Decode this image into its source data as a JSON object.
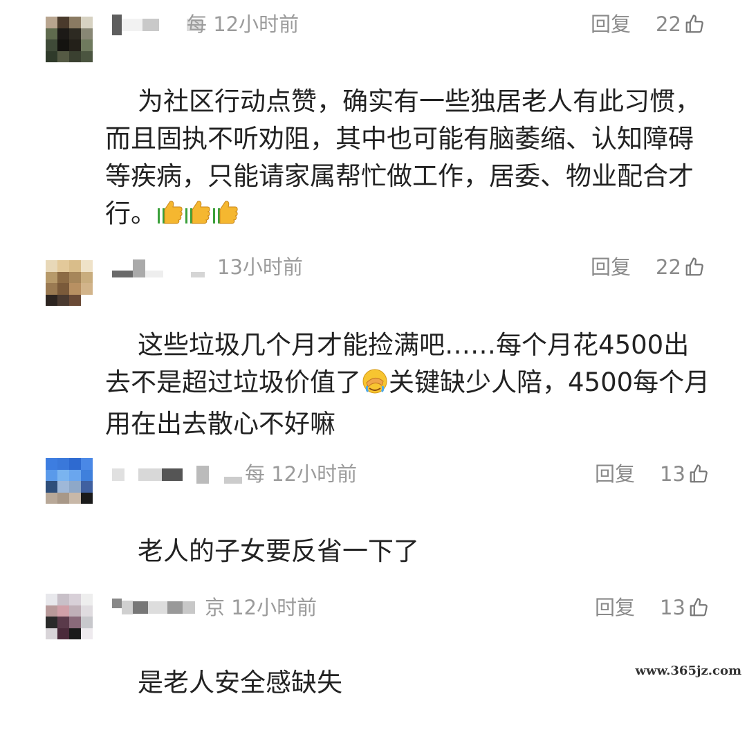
{
  "comments": [
    {
      "location_time": "每 12小时前",
      "reply_label": "回复",
      "likes": "22",
      "text": "为社区行动点赞，确实有一些独居老人有此习惯，而且固执不听劝阻，其中也可能有脑萎缩、认知障碍等疾病，只能请家属帮忙做工作，居委、物业配合才行。",
      "emoji": "thumbs-up x3"
    },
    {
      "location_time": "13小时前",
      "reply_label": "回复",
      "likes": "22",
      "text_a": "这些垃圾几个月才能捡满吧……每个月花4500出去不是超过垃圾价值了",
      "emoji": "facepalm-crying",
      "text_b": "关键缺少人陪，4500每个月用在出去散心不好嘛"
    },
    {
      "location_time": "每 12小时前",
      "reply_label": "回复",
      "likes": "13",
      "text": "老人的子女要反省一下了"
    },
    {
      "location_time": "京 12小时前",
      "reply_label": "回复",
      "likes": "13",
      "text": "是老人安全感缺失"
    }
  ],
  "watermark": "www.365jz.com",
  "icons": {
    "like": "thumbs-up-outline-icon"
  },
  "colors": {
    "meta_gray": "#9b9b9b",
    "text_dark": "#222222"
  }
}
